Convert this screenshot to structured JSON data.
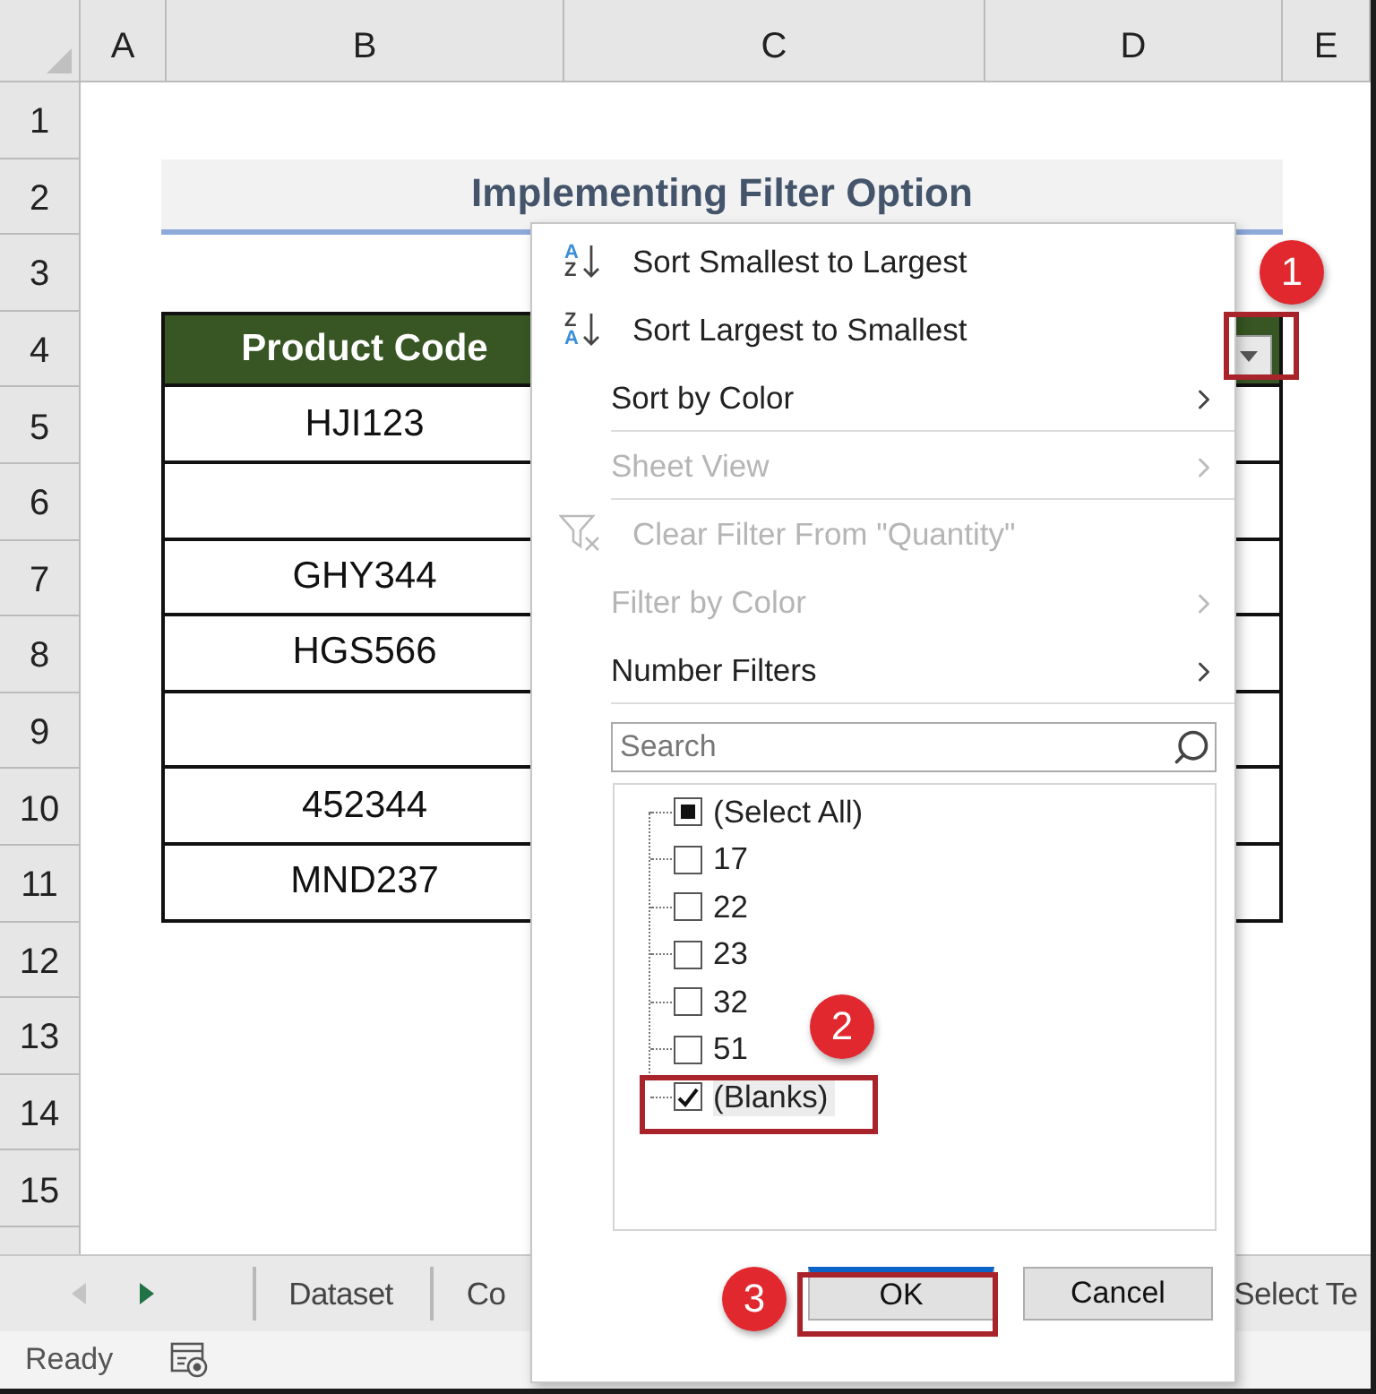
{
  "columns": [
    "A",
    "B",
    "C",
    "D",
    "E"
  ],
  "rows": [
    "1",
    "2",
    "3",
    "4",
    "5",
    "6",
    "7",
    "8",
    "9",
    "10",
    "11",
    "12",
    "13",
    "14",
    "15"
  ],
  "title": "Implementing Filter Option",
  "table": {
    "header": "Product Code",
    "rows": [
      {
        "product_code": "HJI123"
      },
      {},
      {
        "product_code": "GHY344"
      },
      {
        "product_code": "HGS566"
      },
      {},
      {
        "product_code": "452344"
      },
      {
        "product_code": "MND237"
      }
    ]
  },
  "filter_menu": {
    "items": [
      {
        "kind": "sort",
        "icon_letters": [
          "A",
          "Z"
        ],
        "label": "Sort Smallest to Largest",
        "disabled": false,
        "submenu": false,
        "separator_after": false
      },
      {
        "kind": "sort",
        "icon_letters": [
          "Z",
          "A"
        ],
        "label": "Sort Largest to Smallest",
        "disabled": false,
        "submenu": false,
        "separator_after": false
      },
      {
        "kind": "plain",
        "label": "Sort by Color",
        "disabled": false,
        "submenu": true,
        "separator_after": true
      },
      {
        "kind": "plain",
        "label": "Sheet View",
        "disabled": true,
        "submenu": true,
        "separator_after": true
      },
      {
        "kind": "clear",
        "label": "Clear Filter From \"Quantity\"",
        "disabled": true,
        "submenu": false,
        "separator_after": false
      },
      {
        "kind": "plain",
        "label": "Filter by Color",
        "disabled": true,
        "submenu": true,
        "separator_after": false
      },
      {
        "kind": "plain",
        "label": "Number Filters",
        "disabled": false,
        "submenu": true,
        "separator_after": true
      }
    ],
    "search": {
      "placeholder": "Search"
    },
    "options": [
      {
        "label": "(Select All)",
        "checked": false,
        "indeterminate": true,
        "highlighted": false
      },
      {
        "label": "17",
        "checked": false,
        "indeterminate": false,
        "highlighted": false
      },
      {
        "label": "22",
        "checked": false,
        "indeterminate": false,
        "highlighted": false
      },
      {
        "label": "23",
        "checked": false,
        "indeterminate": false,
        "highlighted": false
      },
      {
        "label": "32",
        "checked": false,
        "indeterminate": false,
        "highlighted": false
      },
      {
        "label": "51",
        "checked": false,
        "indeterminate": false,
        "highlighted": false
      },
      {
        "label": "(Blanks)",
        "checked": true,
        "indeterminate": false,
        "highlighted": true
      }
    ],
    "buttons": [
      {
        "label": "OK",
        "default": true
      },
      {
        "label": "Cancel",
        "default": false
      }
    ]
  },
  "sheet_tabs": [
    {
      "label": "Dataset"
    },
    {
      "label": "Co"
    },
    {
      "label": "Select Te"
    }
  ],
  "status": "Ready",
  "callouts": [
    "1",
    "2",
    "3"
  ]
}
